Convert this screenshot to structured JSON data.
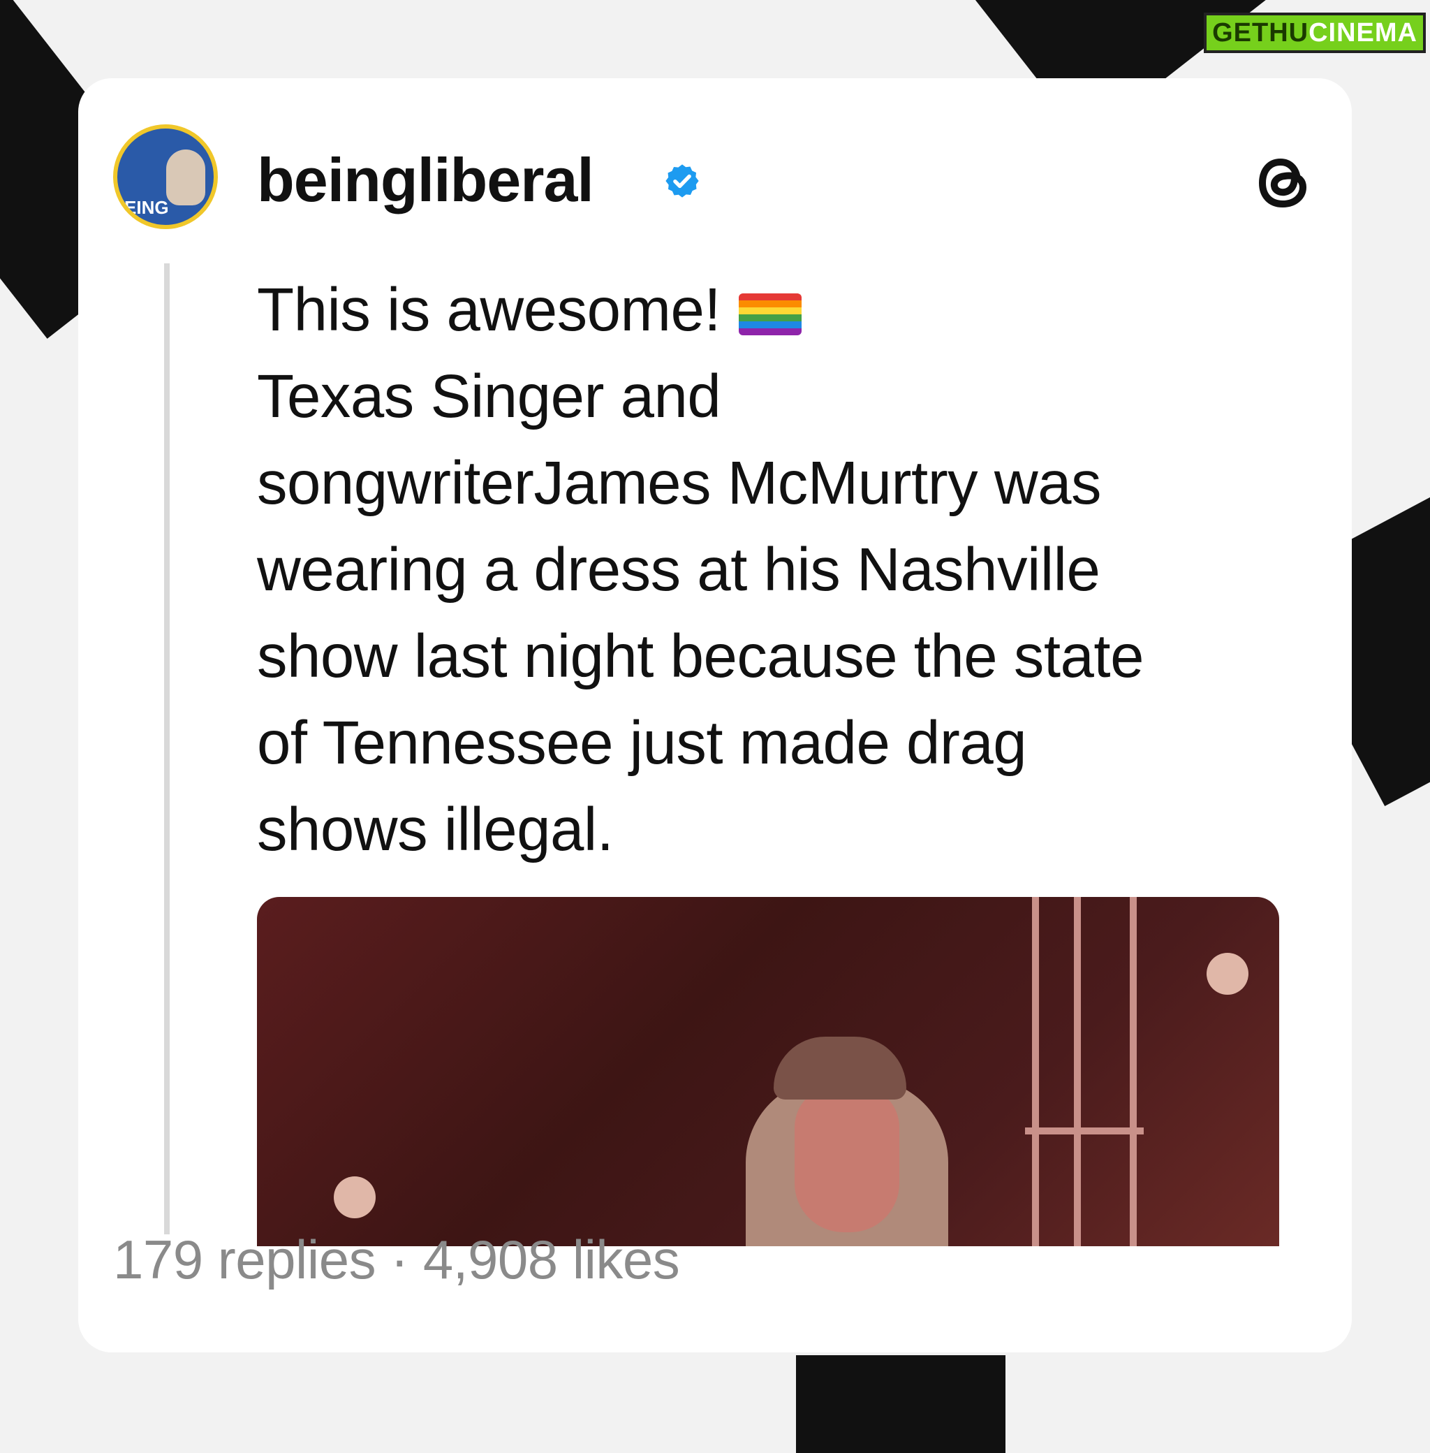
{
  "watermark": {
    "part1": "GETHU",
    "part2": "CINEMA"
  },
  "post": {
    "username": "beingliberal",
    "verified": true,
    "avatar_text": "EING",
    "text_lines": [
      "This is awesome!",
      "Texas Singer and",
      "songwriterJames McMurtry was",
      "wearing a dress at his Nashville",
      "show last night because the state",
      "of Tennessee just made drag",
      "shows illegal."
    ],
    "emoji": "rainbow-flag",
    "stats": "179 replies · 4,908 likes"
  },
  "colors": {
    "verified_blue": "#1d9bf0",
    "stats_gray": "#8a8a8a",
    "watermark_green": "#76d01c"
  },
  "icons": {
    "threads": "threads-logo-icon",
    "verified": "verified-badge-icon"
  }
}
